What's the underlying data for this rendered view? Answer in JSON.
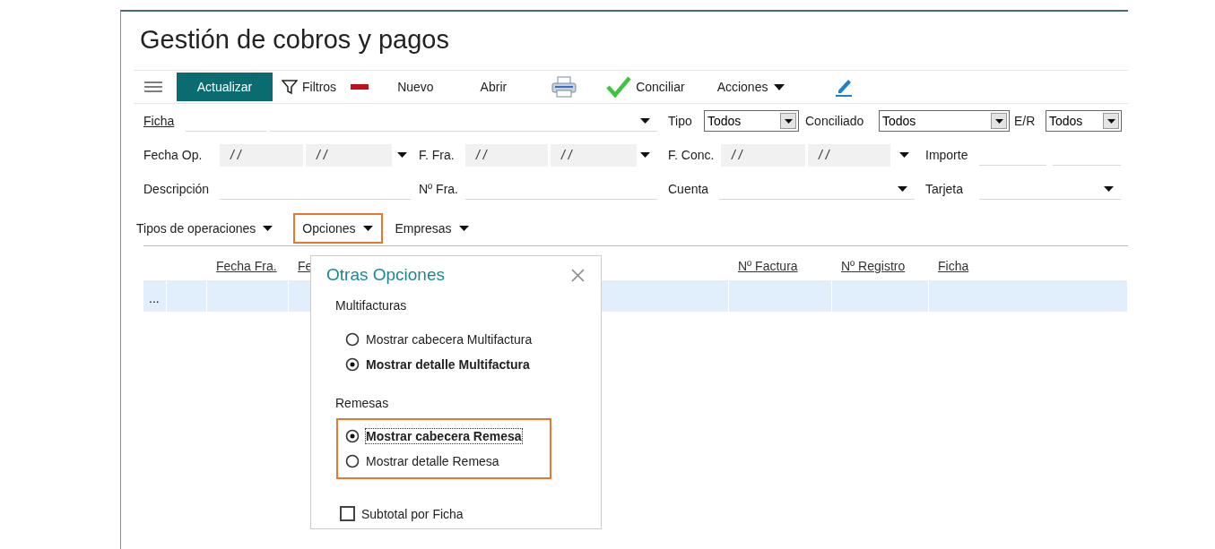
{
  "title": "Gestión de cobros y pagos",
  "toolbar": [
    {
      "kind": "menu"
    },
    {
      "kind": "primary",
      "label": "Actualizar"
    },
    {
      "kind": "filter",
      "label": "Filtros"
    },
    {
      "kind": "remove"
    },
    {
      "kind": "text",
      "label": "Nuevo"
    },
    {
      "kind": "text",
      "label": "Abrir"
    },
    {
      "kind": "print"
    },
    {
      "kind": "check",
      "label": "Conciliar"
    },
    {
      "kind": "dropdown",
      "label": "Acciones"
    },
    {
      "kind": "edit"
    }
  ],
  "filters": [
    [
      {
        "kind": "link",
        "label": "Ficha"
      },
      {
        "kind": "input"
      },
      {
        "kind": "combo"
      },
      {
        "kind": "label",
        "label": "Tipo"
      },
      {
        "kind": "select",
        "value": "Todos"
      },
      {
        "kind": "label",
        "label": "Conciliado"
      },
      {
        "kind": "select",
        "value": "Todos"
      },
      {
        "kind": "label",
        "label": "E/R"
      },
      {
        "kind": "select",
        "value": "Todos"
      }
    ],
    [
      {
        "kind": "label",
        "label": "Fecha Op."
      },
      {
        "kind": "date",
        "value": "/ /"
      },
      {
        "kind": "date",
        "value": "/ /"
      },
      {
        "kind": "caret"
      },
      {
        "kind": "label",
        "label": "F. Fra."
      },
      {
        "kind": "date",
        "value": "/ /"
      },
      {
        "kind": "date",
        "value": "/ /"
      },
      {
        "kind": "caret"
      },
      {
        "kind": "label",
        "label": "F. Conc."
      },
      {
        "kind": "date",
        "value": "/ /"
      },
      {
        "kind": "date",
        "value": "/ /"
      },
      {
        "kind": "caret"
      },
      {
        "kind": "label",
        "label": "Importe"
      },
      {
        "kind": "input"
      },
      {
        "kind": "input"
      }
    ],
    [
      {
        "kind": "label",
        "label": "Descripción"
      },
      {
        "kind": "input"
      },
      {
        "kind": "label",
        "label": "Nº Fra."
      },
      {
        "kind": "input"
      },
      {
        "kind": "label",
        "label": "Cuenta"
      },
      {
        "kind": "combo"
      },
      {
        "kind": "label",
        "label": "Tarjeta"
      },
      {
        "kind": "combo"
      }
    ]
  ],
  "option_menus": [
    {
      "label": "Tipos de operaciones",
      "highlighted": false
    },
    {
      "label": "Opciones",
      "highlighted": true
    },
    {
      "label": "Empresas",
      "highlighted": false
    }
  ],
  "table": {
    "columns": [
      {
        "kind": "blank"
      },
      {
        "kind": "blank"
      },
      {
        "kind": "sort",
        "label": "Fecha Fra."
      },
      {
        "kind": "sort",
        "label": "Fe"
      },
      {
        "kind": "sort",
        "label": "Nº Factura"
      },
      {
        "kind": "sort",
        "label": "Nº Registro"
      },
      {
        "kind": "sort",
        "label": "Ficha"
      }
    ],
    "rows": [
      {
        "cells": [
          "..."
        ],
        "selected": true
      }
    ]
  },
  "popup": {
    "title": "Otras Opciones",
    "groups": [
      {
        "title": "Multifacturas",
        "highlighted": false,
        "options": [
          {
            "label": "Mostrar cabecera Multifactura",
            "selected": false,
            "focused": false
          },
          {
            "label": "Mostrar detalle Multifactura",
            "selected": true,
            "focused": false
          }
        ]
      },
      {
        "title": "Remesas",
        "highlighted": true,
        "options": [
          {
            "label": "Mostrar cabecera Remesa",
            "selected": true,
            "focused": true
          },
          {
            "label": "Mostrar detalle Remesa",
            "selected": false,
            "focused": false
          }
        ]
      }
    ],
    "checkbox": {
      "label": "Subtotal por Ficha",
      "checked": false
    }
  }
}
